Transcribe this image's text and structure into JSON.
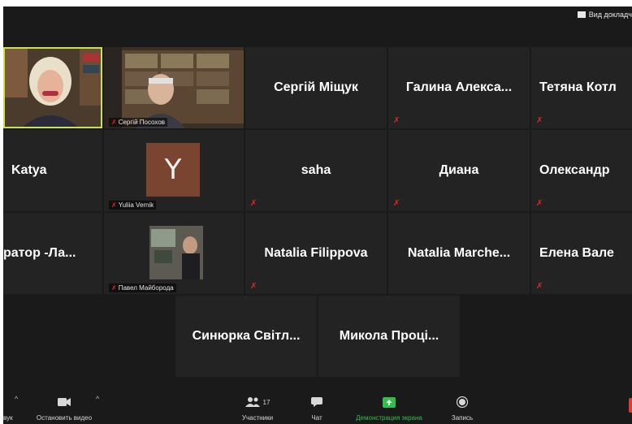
{
  "top": {
    "view_label": "Вид докладч"
  },
  "tiles": {
    "speaker": {},
    "t2": {
      "label": "Сергій Посохов"
    },
    "t3": {
      "name": "Сергій Міщук"
    },
    "t4": {
      "name": "Галина Алекса..."
    },
    "t5": {
      "name": "Тетяна Котл"
    },
    "t6": {
      "name": "Katya"
    },
    "t7": {
      "label": "Yuliia Vernik",
      "initial": "Y"
    },
    "t8": {
      "name": "saha"
    },
    "t9": {
      "name": "Диана"
    },
    "t10": {
      "name": "Олександр"
    },
    "t11": {
      "name": "ратор -Ла..."
    },
    "t12": {
      "label": "Павел Майборода"
    },
    "t13": {
      "name": "Natalia Filippova"
    },
    "t14": {
      "name": "Natalia Marche..."
    },
    "t15": {
      "name": "Елена Вале"
    },
    "t16": {
      "name": "Синюрка Світл..."
    },
    "t17": {
      "name": "Микола Проці..."
    }
  },
  "toolbar": {
    "audio_label": "вук",
    "video_label": "Остановить видео",
    "participants_label": "Участники",
    "participants_count": "17",
    "chat_label": "Чат",
    "share_label": "Демонстрация экрана",
    "record_label": "Запись"
  },
  "colors": {
    "background": "#1a1a1a",
    "tile": "#232323",
    "speaker_border": "#c7e24a",
    "muted": "#e02828",
    "share_green": "#2fbf4a"
  }
}
